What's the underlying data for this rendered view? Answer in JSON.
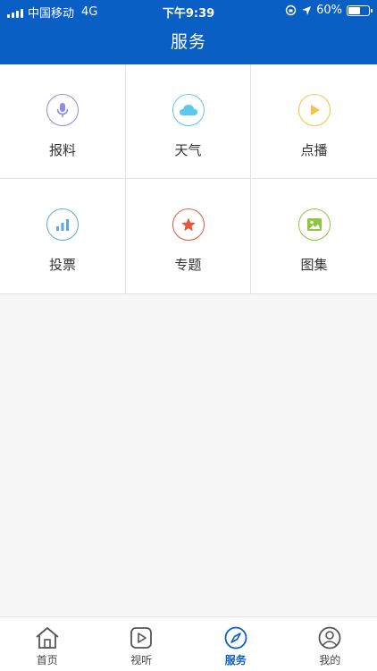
{
  "status": {
    "carrier": "中国移动",
    "network": "4G",
    "time": "下午9:39",
    "battery": "60%",
    "battery_level": 0.6
  },
  "header": {
    "title": "服务"
  },
  "services": [
    {
      "label": "报料",
      "icon": "microphone-icon",
      "color": "#8e8ce8"
    },
    {
      "label": "天气",
      "icon": "cloud-icon",
      "color": "#5cc8ef"
    },
    {
      "label": "点播",
      "icon": "play-icon",
      "color": "#f5c24a"
    },
    {
      "label": "投票",
      "icon": "bar-chart-icon",
      "color": "#5aa9e6"
    },
    {
      "label": "专题",
      "icon": "star-icon",
      "color": "#e8553f"
    },
    {
      "label": "图集",
      "icon": "image-icon",
      "color": "#8dc63f"
    }
  ],
  "tabs": [
    {
      "label": "首页",
      "icon": "home-icon"
    },
    {
      "label": "视听",
      "icon": "video-play-icon"
    },
    {
      "label": "服务",
      "icon": "compass-icon",
      "active": true
    },
    {
      "label": "我的",
      "icon": "user-icon"
    }
  ],
  "colors": {
    "brand": "#0a5fc4",
    "active_tab": "#0a5fc4"
  }
}
